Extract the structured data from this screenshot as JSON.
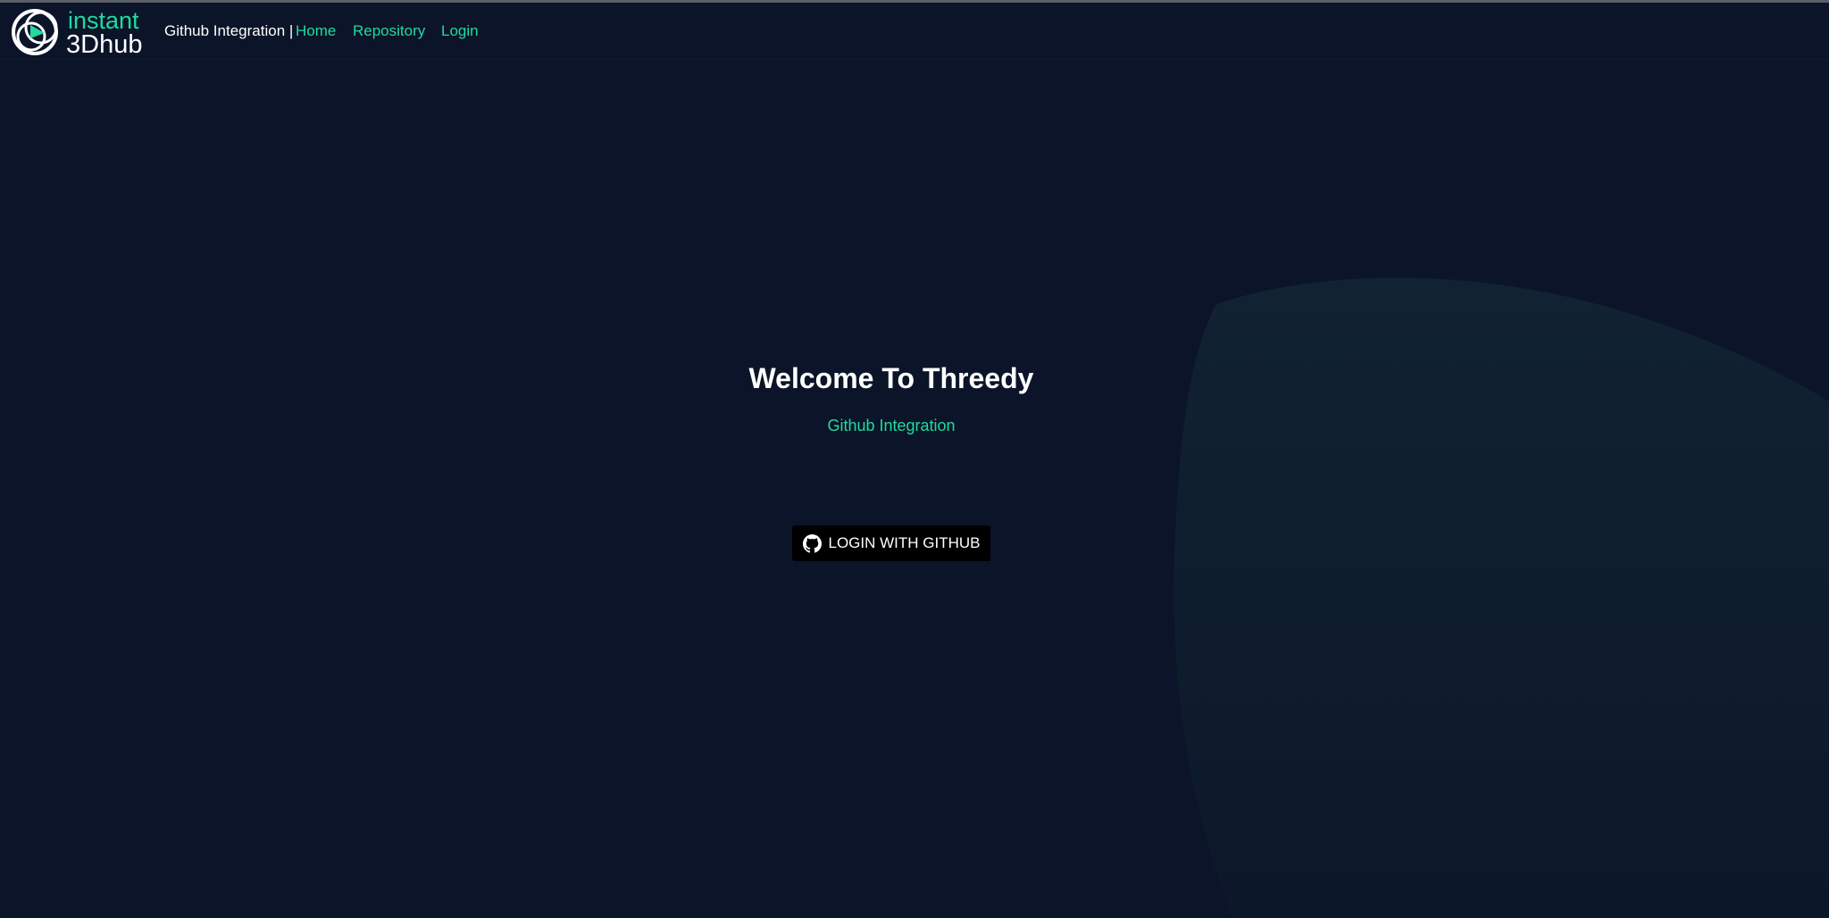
{
  "nav": {
    "logo_text_top": "instant",
    "logo_text_bottom": "3Dhub",
    "brand": "Github Integration |",
    "links": [
      {
        "label": "Home"
      },
      {
        "label": "Repository"
      },
      {
        "label": "Login"
      }
    ]
  },
  "hero": {
    "title": "Welcome To Threedy",
    "subtitle": "Github Integration",
    "login_button": {
      "label": "LOGIN WITH GITHUB",
      "icon": "github-icon"
    }
  },
  "colors": {
    "background": "#0b1428",
    "accent": "#21d9a0",
    "text": "#ffffff",
    "button_bg": "#000000"
  }
}
